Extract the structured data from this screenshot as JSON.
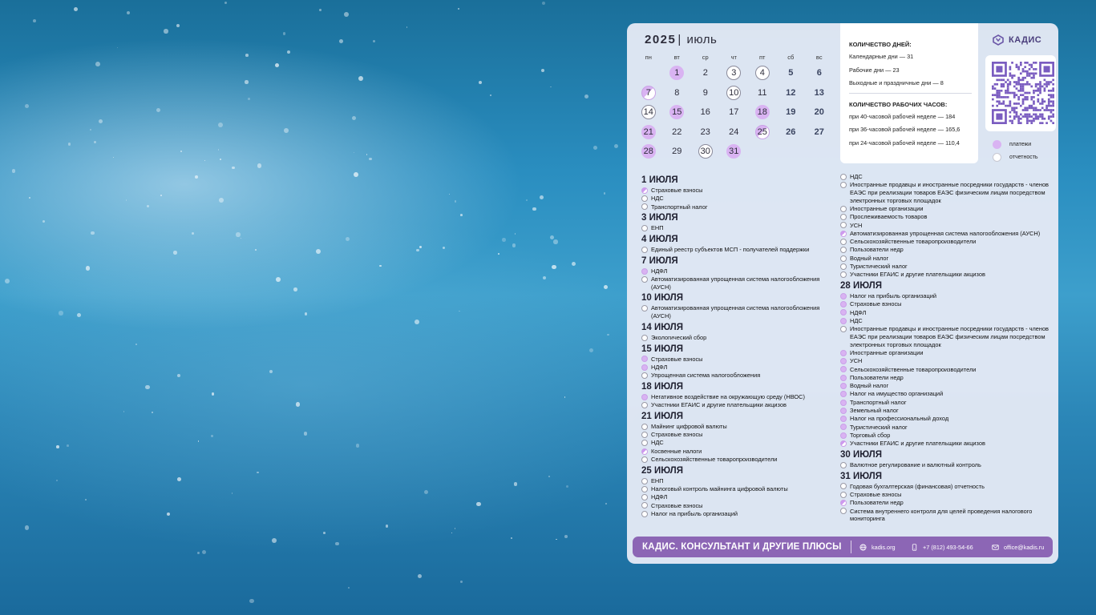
{
  "calendar": {
    "year": "2025",
    "separator": "|",
    "month": "июль",
    "weekdays": [
      "пн",
      "вт",
      "ср",
      "чт",
      "пт",
      "сб",
      "вс"
    ],
    "weeks": [
      [
        {
          "d": ""
        },
        {
          "d": "1",
          "m": "pay"
        },
        {
          "d": "2"
        },
        {
          "d": "3",
          "m": "rep"
        },
        {
          "d": "4",
          "m": "rep"
        },
        {
          "d": "5",
          "we": true
        },
        {
          "d": "6",
          "we": true
        }
      ],
      [
        {
          "d": "7",
          "m": "half"
        },
        {
          "d": "8"
        },
        {
          "d": "9"
        },
        {
          "d": "10",
          "m": "rep"
        },
        {
          "d": "11"
        },
        {
          "d": "12",
          "we": true
        },
        {
          "d": "13",
          "we": true
        }
      ],
      [
        {
          "d": "14",
          "m": "rep"
        },
        {
          "d": "15",
          "m": "pay"
        },
        {
          "d": "16"
        },
        {
          "d": "17"
        },
        {
          "d": "18",
          "m": "pay"
        },
        {
          "d": "19",
          "we": true
        },
        {
          "d": "20",
          "we": true
        }
      ],
      [
        {
          "d": "21",
          "m": "pay"
        },
        {
          "d": "22"
        },
        {
          "d": "23"
        },
        {
          "d": "24"
        },
        {
          "d": "25",
          "m": "half"
        },
        {
          "d": "26",
          "we": true
        },
        {
          "d": "27",
          "we": true
        }
      ],
      [
        {
          "d": "28",
          "m": "pay"
        },
        {
          "d": "29"
        },
        {
          "d": "30",
          "m": "rep"
        },
        {
          "d": "31",
          "m": "pay"
        },
        {
          "d": ""
        },
        {
          "d": ""
        },
        {
          "d": ""
        }
      ]
    ]
  },
  "info": {
    "days_title": "КОЛИЧЕСТВО ДНЕЙ:",
    "calendar_days": "Календарные дни — 31",
    "work_days": "Рабочие дни — 23",
    "holidays": "Выходные и праздничные дни — 8",
    "hours_title": "КОЛИЧЕСТВО РАБОЧИХ ЧАСОВ:",
    "hours_40": "при 40-часовой рабочей неделе — 184",
    "hours_36": "при 36-часовой рабочей неделе — 165,6",
    "hours_24": "при 24-часовой рабочей неделе — 110,4"
  },
  "brand": {
    "logo_text": "КАДИС",
    "accent_color": "#8c66b5",
    "payment_color": "#d9b3f2"
  },
  "legend": {
    "payments": "платежи",
    "reports": "отчетность"
  },
  "events_left": [
    {
      "date": "1 ИЮЛЯ",
      "items": [
        {
          "t": "Страховые взносы",
          "m": "half"
        },
        {
          "t": "НДС",
          "m": "rep"
        },
        {
          "t": "Транспортный налог",
          "m": "rep"
        }
      ]
    },
    {
      "date": "3 ИЮЛЯ",
      "items": [
        {
          "t": "ЕНП",
          "m": "rep"
        }
      ]
    },
    {
      "date": "4 ИЮЛЯ",
      "items": [
        {
          "t": "Единый реестр субъектов МСП - получателей поддержки",
          "m": "rep"
        }
      ]
    },
    {
      "date": "7 ИЮЛЯ",
      "items": [
        {
          "t": "НДФЛ",
          "m": "pay"
        },
        {
          "t": "Автоматизированная упрощенная система налогообложения (АУСН)",
          "m": "rep"
        }
      ]
    },
    {
      "date": "10 ИЮЛЯ",
      "items": [
        {
          "t": "Автоматизированная упрощенная система налогообложения (АУСН)",
          "m": "rep"
        }
      ]
    },
    {
      "date": "14 ИЮЛЯ",
      "items": [
        {
          "t": "Экологический сбор",
          "m": "rep"
        }
      ]
    },
    {
      "date": "15 ИЮЛЯ",
      "items": [
        {
          "t": "Страховые взносы",
          "m": "pay"
        },
        {
          "t": "НДФЛ",
          "m": "pay"
        },
        {
          "t": "Упрощенная система налогообложения",
          "m": "rep"
        }
      ]
    },
    {
      "date": "18 ИЮЛЯ",
      "items": [
        {
          "t": "Негативное воздействие на окружающую среду (НВОС)",
          "m": "pay"
        },
        {
          "t": "Участники ЕГАИС и другие плательщики акцизов",
          "m": "rep"
        }
      ]
    },
    {
      "date": "21 ИЮЛЯ",
      "items": [
        {
          "t": "Майнинг цифровой валюты",
          "m": "rep"
        },
        {
          "t": "Страховые взносы",
          "m": "rep"
        },
        {
          "t": "НДС",
          "m": "rep"
        },
        {
          "t": "Косвенные налоги",
          "m": "half"
        },
        {
          "t": "Сельскохозяйственные товаропроизводители",
          "m": "rep"
        }
      ]
    },
    {
      "date": "25 ИЮЛЯ",
      "items": [
        {
          "t": "ЕНП",
          "m": "rep"
        },
        {
          "t": "Налоговый контроль майнинга цифровой валюты",
          "m": "rep"
        },
        {
          "t": "НДФЛ",
          "m": "rep"
        },
        {
          "t": "Страховые взносы",
          "m": "rep"
        },
        {
          "t": "Налог на прибыль организаций",
          "m": "rep"
        }
      ]
    }
  ],
  "events_right": [
    {
      "date": "",
      "items": [
        {
          "t": "НДС",
          "m": "rep"
        },
        {
          "t": "Иностранные продавцы и иностранные посредники государств - членов ЕАЭС при реализации товаров ЕАЭС физическим лицам посредством электронных торговых площадок",
          "m": "rep"
        },
        {
          "t": "Иностранные организации",
          "m": "rep"
        },
        {
          "t": "Прослеживаемость товаров",
          "m": "rep"
        },
        {
          "t": "УСН",
          "m": "rep"
        },
        {
          "t": "Автоматизированная упрощенная система налогообложения (АУСН)",
          "m": "half"
        },
        {
          "t": "Сельскохозяйственные товаропроизводители",
          "m": "rep"
        },
        {
          "t": "Пользователи недр",
          "m": "rep"
        },
        {
          "t": "Водный налог",
          "m": "rep"
        },
        {
          "t": "Туристический налог",
          "m": "rep"
        },
        {
          "t": "Участники ЕГАИС и другие плательщики акцизов",
          "m": "rep"
        }
      ]
    },
    {
      "date": "28 ИЮЛЯ",
      "items": [
        {
          "t": "Налог на прибыль организаций",
          "m": "pay"
        },
        {
          "t": "Страховые взносы",
          "m": "pay"
        },
        {
          "t": "НДФЛ",
          "m": "pay"
        },
        {
          "t": "НДС",
          "m": "pay"
        },
        {
          "t": "Иностранные продавцы и иностранные посредники государств - членов ЕАЭС при реализации товаров ЕАЭС физическим лицам посредством электронных торговых площадок",
          "m": "rep"
        },
        {
          "t": "Иностранные организации",
          "m": "pay"
        },
        {
          "t": "УСН",
          "m": "pay"
        },
        {
          "t": "Сельскохозяйственные товаропроизводители",
          "m": "pay"
        },
        {
          "t": "Пользователи недр",
          "m": "pay"
        },
        {
          "t": "Водный налог",
          "m": "pay"
        },
        {
          "t": "Налог на имущество организаций",
          "m": "pay"
        },
        {
          "t": "Транспортный налог",
          "m": "pay"
        },
        {
          "t": "Земельный налог",
          "m": "pay"
        },
        {
          "t": "Налог на профессиональный доход",
          "m": "pay"
        },
        {
          "t": "Туристический налог",
          "m": "pay"
        },
        {
          "t": "Торговый сбор",
          "m": "pay"
        },
        {
          "t": "Участники ЕГАИС и другие плательщики акцизов",
          "m": "half"
        }
      ]
    },
    {
      "date": "30 ИЮЛЯ",
      "items": [
        {
          "t": "Валютное регулирование и валютный контроль",
          "m": "rep"
        }
      ]
    },
    {
      "date": "31 ИЮЛЯ",
      "items": [
        {
          "t": "Годовая бухгалтерская (финансовая) отчетность",
          "m": "rep"
        },
        {
          "t": "Страховые взносы",
          "m": "rep"
        },
        {
          "t": "Пользователи недр",
          "m": "half"
        },
        {
          "t": "Система внутреннего контроля для целей проведения налогового мониторинга",
          "m": "rep"
        }
      ]
    }
  ],
  "footer": {
    "title": "КАДИС. КОНСУЛЬТАНТ И ДРУГИЕ ПЛЮСЫ",
    "website": "kadis.org",
    "phone": "+7 (812) 493-54-66",
    "email": "office@kadis.ru"
  }
}
